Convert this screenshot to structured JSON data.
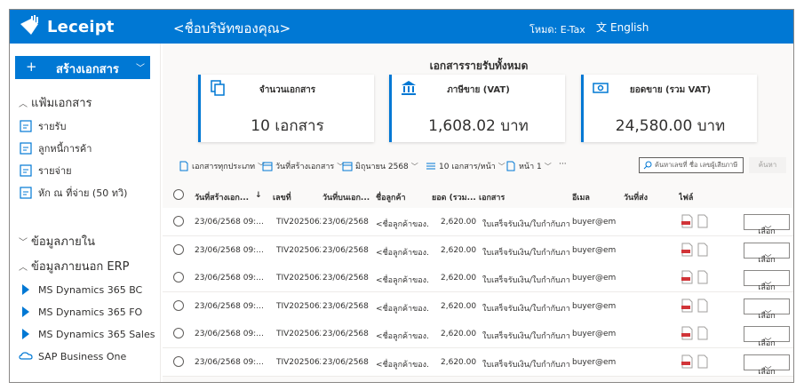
{
  "app": {
    "logo_text": "Leceipt",
    "company": "<ชื่อบริษัทของคุณ>",
    "mode_link": "โหมด: E-Tax",
    "language_link": "English",
    "brand_color": "#0078d4"
  },
  "sidebar": {
    "create_label": "สร้างเอกสาร",
    "folders_label": "แฟ้มเอกสาร",
    "folder_items": [
      "รายรับ",
      "ลูกหนี้การค้า",
      "รายจ่าย",
      "หัก ณ ที่จ่าย (50 ทวิ)"
    ],
    "internal_label": "ข้อมูลภายใน",
    "erp_label": "ข้อมูลภายนอก ERP",
    "erp_items": [
      "MS Dynamics 365 BC",
      "MS Dynamics 365 FO",
      "MS Dynamics 365 Sales",
      "SAP Business One"
    ]
  },
  "main": {
    "title": "เอกสารรายรับทั้งหมด",
    "cards": [
      {
        "title": "จำนวนเอกสาร",
        "value": "10 เอกสาร",
        "icon": "documents-icon"
      },
      {
        "title": "ภาษีขาย (VAT)",
        "value": "1,608.02 บาท",
        "icon": "bank-icon"
      },
      {
        "title": "ยอดขาย (รวม VAT)",
        "value": "24,580.00 บาท",
        "icon": "money-icon"
      }
    ]
  },
  "toolbar": {
    "doc_type": "เอกสารทุกประเภท",
    "date_type": "วันที่สร้างเอกสาร",
    "month": "มิถุนายน 2568",
    "page_size": "10 เอกสาร/หน้า",
    "page": "หน้า 1",
    "more": "···",
    "search_placeholder": "ค้นหาเลขที่ ชื่อ เลขผู้เสียภาษี",
    "search_button": "ค้นหา"
  },
  "table": {
    "headers": [
      "วันที่สร้างเอก...",
      "↓",
      "เลขที่",
      "วันที่บนเอก...",
      "ชื่อลูกค้า",
      "ยอด (รวม...",
      "เอกสาร",
      "อีเมล",
      "วันที่ส่ง",
      "ไฟล์"
    ],
    "select_label": "เลือก",
    "rows": [
      [
        "23/06/2568 09:...",
        "TIV2025062:",
        "23/06/2568",
        "<ชื่อลูกค้าของ...",
        "2,620.00",
        "ใบเสร็จรับเงิน/ใบกำกับภาษี",
        "buyer@em..."
      ],
      [
        "23/06/2568 09:...",
        "TIV2025062:",
        "23/06/2568",
        "<ชื่อลูกค้าของ...",
        "2,620.00",
        "ใบเสร็จรับเงิน/ใบกำกับภาษี",
        "buyer@em..."
      ],
      [
        "23/06/2568 09:...",
        "TIV2025062:",
        "23/06/2568",
        "<ชื่อลูกค้าของ...",
        "2,620.00",
        "ใบเสร็จรับเงิน/ใบกำกับภาษี",
        "buyer@em..."
      ],
      [
        "23/06/2568 09:...",
        "TIV2025062:",
        "23/06/2568",
        "<ชื่อลูกค้าของ...",
        "2,620.00",
        "ใบเสร็จรับเงิน/ใบกำกับภาษี",
        "buyer@em..."
      ],
      [
        "23/06/2568 09:...",
        "TIV2025062:",
        "23/06/2568",
        "<ชื่อลูกค้าของ...",
        "2,620.00",
        "ใบเสร็จรับเงิน/ใบกำกับภาษี",
        "buyer@em..."
      ],
      [
        "23/06/2568 09:...",
        "TIV2025062:",
        "23/06/2568",
        "<ชื่อลูกค้าของ...",
        "2,620.00",
        "ใบเสร็จรับเงิน/ใบกำกับภาษี",
        "buyer@em..."
      ]
    ]
  }
}
